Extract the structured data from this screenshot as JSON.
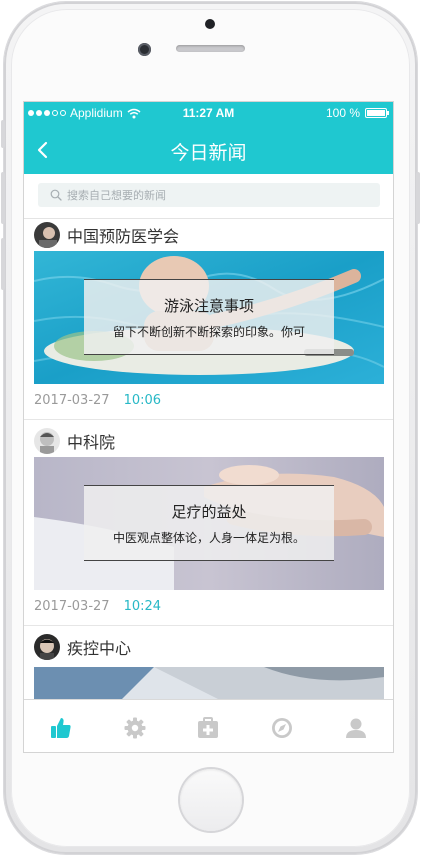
{
  "status_bar": {
    "carrier": "Applidium",
    "time": "11:27 AM",
    "battery": "100 %"
  },
  "nav": {
    "title": "今日新闻",
    "back_icon": "chevron-left-icon"
  },
  "search": {
    "placeholder": "搜索自己想要的新闻",
    "icon": "search-icon"
  },
  "feed": {
    "items": [
      {
        "source": "中国预防医学会",
        "headline": "游泳注意事项",
        "summary": "留下不断创新不断探索的印象。你可",
        "date": "2017-03-27",
        "time": "10:06"
      },
      {
        "source": "中科院",
        "headline": "足疗的益处",
        "summary": "中医观点整体论，人身一体足为根。",
        "date": "2017-03-27",
        "time": "10:24"
      },
      {
        "source": "疾控中心"
      }
    ]
  },
  "tabbar": {
    "tabs": [
      {
        "icon": "thumbs-up-icon",
        "active": true
      },
      {
        "icon": "gear-icon",
        "active": false
      },
      {
        "icon": "medical-kit-icon",
        "active": false
      },
      {
        "icon": "compass-icon",
        "active": false
      },
      {
        "icon": "person-icon",
        "active": false
      }
    ]
  },
  "colors": {
    "accent": "#1fc8d0",
    "time_text": "#27b8c6",
    "tab_inactive": "#c9c9c9"
  }
}
